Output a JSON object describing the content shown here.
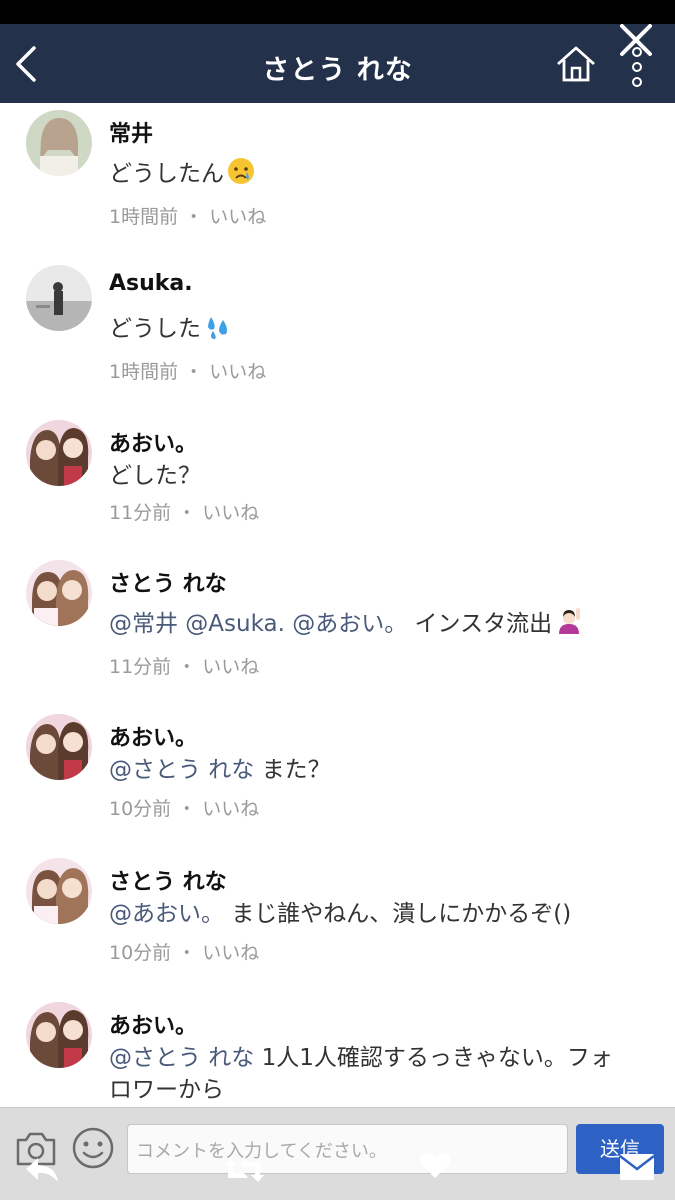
{
  "header": {
    "title": "さとう れな"
  },
  "comments": [
    {
      "name": "常井",
      "text": "どうしたん",
      "emoji": "crying-face-emoji",
      "time": "1時間前",
      "like": "いいね"
    },
    {
      "name": "Asuka.",
      "text": "どうした",
      "emoji": "sweat-droplets-emoji",
      "time": "1時間前",
      "like": "いいね"
    },
    {
      "name": "あおい。",
      "text": "どした？",
      "time": "11分前",
      "like": "いいね"
    },
    {
      "name": "さとう れな",
      "mention": "@常井 @Asuka. @あおい。",
      "text": " インスタ流出",
      "emoji": "person-raising-hand-emoji",
      "time": "11分前",
      "like": "いいね"
    },
    {
      "name": "あおい。",
      "mention": "@さとう れな",
      "text": " また？",
      "time": "10分前",
      "like": "いいね"
    },
    {
      "name": "さとう れな",
      "mention": "@あおい。",
      "text": " まじ誰やねん、潰しにかかるぞ()",
      "time": "10分前",
      "like": "いいね"
    },
    {
      "name": "あおい。",
      "mention": "@さとう れな",
      "text": " 1人1人確認するっきゃない。フォロワーから"
    }
  ],
  "meta_separator": "・",
  "composer": {
    "placeholder": "コメントを入力してください。",
    "send_label": "送信"
  },
  "colors": {
    "header_bg": "#24314a",
    "send_bg": "#2d62c4",
    "mention": "#4a5a7a"
  }
}
